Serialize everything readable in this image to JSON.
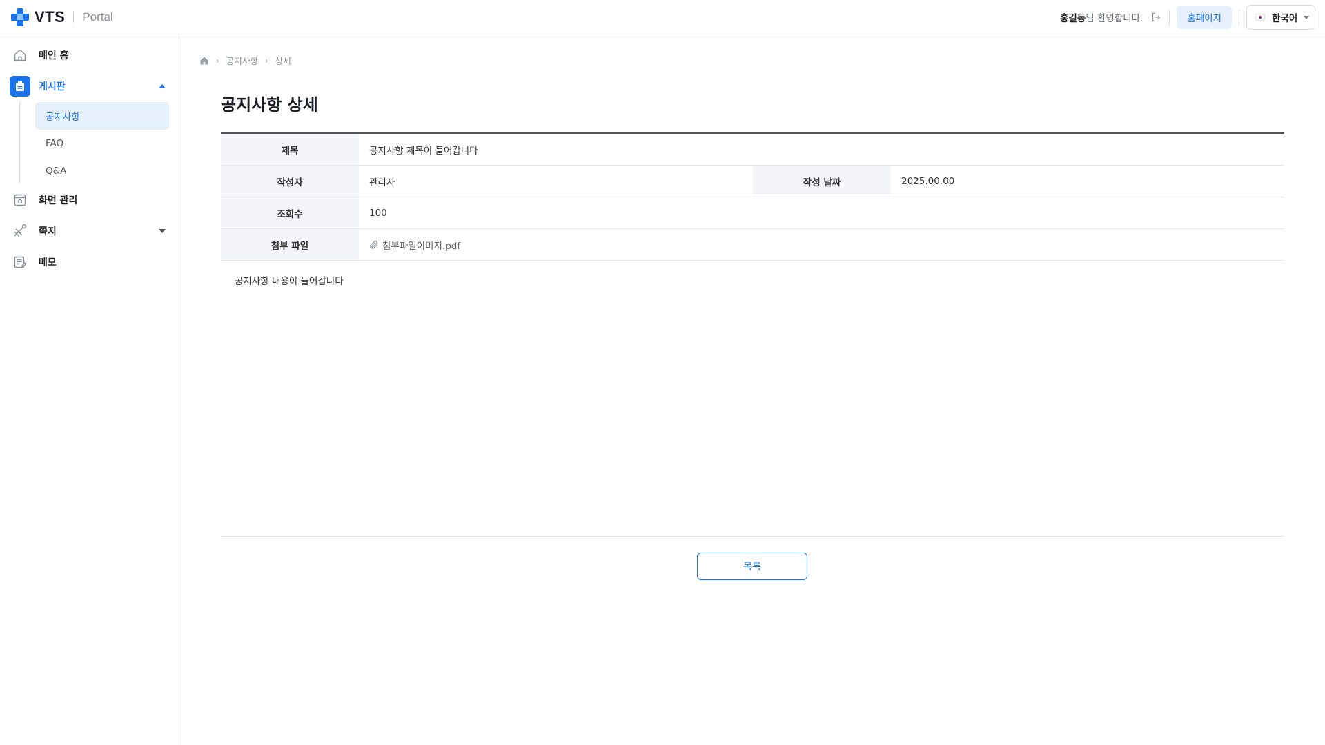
{
  "header": {
    "logo_text": "VTS",
    "logo_sub": "Portal",
    "user_name": "홍길동",
    "welcome_suffix": "님 환영합니다.",
    "homepage_label": "홈페이지",
    "language": "한국어",
    "brand_color": "#1a73e8"
  },
  "sidebar": {
    "items": [
      {
        "label": "메인 홈",
        "icon": "home-icon"
      },
      {
        "label": "게시판",
        "icon": "board-icon",
        "expanded": true,
        "active": true
      },
      {
        "label": "화면 관리",
        "icon": "screen-settings-icon"
      },
      {
        "label": "쪽지",
        "icon": "message-icon",
        "expanded": false
      },
      {
        "label": "메모",
        "icon": "memo-icon"
      }
    ],
    "board_sub": [
      {
        "label": "공지사항",
        "active": true
      },
      {
        "label": "FAQ"
      },
      {
        "label": "Q&A"
      }
    ]
  },
  "breadcrumb": {
    "items": [
      "공지사항",
      "상세"
    ]
  },
  "page": {
    "title": "공지사항 상세"
  },
  "detail": {
    "title_label": "제목",
    "title_value": "공지사항 제목이 들어갑니다",
    "author_label": "작성자",
    "author_value": "관리자",
    "date_label": "작성 날짜",
    "date_value": "2025.00.00",
    "views_label": "조회수",
    "views_value": "100",
    "attach_label": "첨부 파일",
    "attach_value": "첨부파일이미지.pdf"
  },
  "content": {
    "body": "공지사항 내용이 들어갑니다"
  },
  "actions": {
    "list_label": "목록"
  }
}
